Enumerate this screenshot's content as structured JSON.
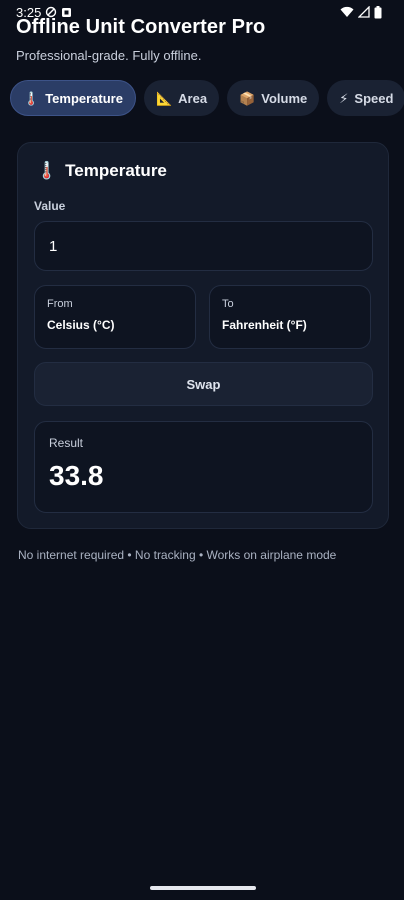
{
  "status_bar": {
    "time": "3:25"
  },
  "header": {
    "title": "Offline Unit Converter Pro",
    "subtitle": "Professional-grade. Fully offline."
  },
  "tabs": [
    {
      "icon": "🌡️",
      "label": "Temperature",
      "active": true
    },
    {
      "icon": "📐",
      "label": "Area",
      "active": false
    },
    {
      "icon": "📦",
      "label": "Volume",
      "active": false
    },
    {
      "icon": "⚡",
      "label": "Speed",
      "active": false
    }
  ],
  "card": {
    "icon": "🌡️",
    "title": "Temperature",
    "value_label": "Value",
    "value": "1",
    "from_label": "From",
    "from_value": "Celsius (°C)",
    "to_label": "To",
    "to_value": "Fahrenheit (°F)",
    "swap_label": "Swap",
    "result_label": "Result",
    "result_value": "33.8"
  },
  "footer": {
    "text": "No internet required • No tracking • Works on airplane mode"
  },
  "colors": {
    "background": "#0b0f1a",
    "card": "#131a29",
    "active_tab": "#2b3d66"
  }
}
